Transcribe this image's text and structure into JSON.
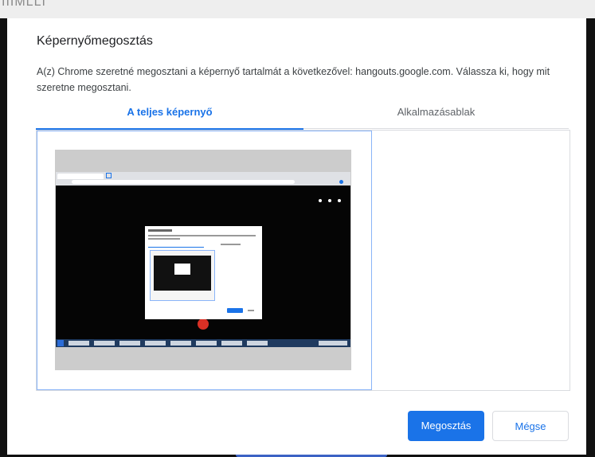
{
  "backdrop": {
    "partial_text": "IIIMLLI"
  },
  "dialog": {
    "title": "Képernyőmegosztás",
    "message": "A(z) Chrome szeretné megosztani a képernyő tartalmát a következővel: hangouts.google.com. Válassza ki, hogy mit szeretne megosztani.",
    "tabs": [
      {
        "label": "A teljes képernyő",
        "selected": true
      },
      {
        "label": "Alkalmazásablak",
        "selected": false
      }
    ],
    "share_label": "Megosztás",
    "cancel_label": "Mégse"
  },
  "colors": {
    "accent": "#1a73e8",
    "end_call": "#d93025",
    "border": "#dadce0"
  }
}
